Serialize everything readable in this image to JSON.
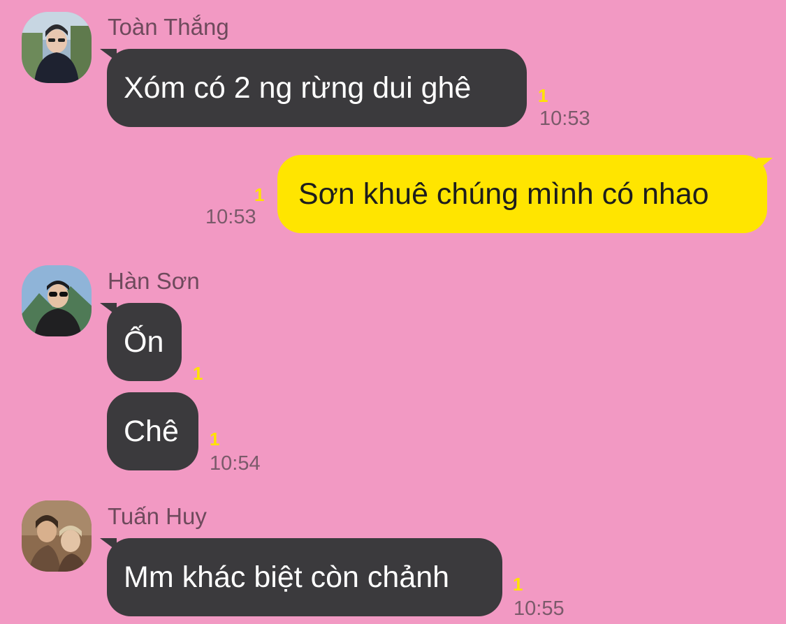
{
  "colors": {
    "background": "#f299c3",
    "incoming_bubble": "#3b3a3d",
    "outgoing_bubble": "#ffe500",
    "unread_count": "#ffe300",
    "meta_text": "#7a5a6a"
  },
  "messages": [
    {
      "sender": "Toàn Thắng",
      "avatar_icon": "avatar-photo-icon",
      "text": "Xóm có 2 ng rừng dui ghê",
      "unread": "1",
      "time": "10:53"
    },
    {
      "direction": "outgoing",
      "text": "Sơn khuê chúng mình có nhao",
      "unread": "1",
      "time": "10:53"
    },
    {
      "sender": "Hàn Sơn",
      "avatar_icon": "avatar-photo-icon",
      "text": "Ốn",
      "unread": "1"
    },
    {
      "text": "Chê",
      "unread": "1",
      "time": "10:54"
    },
    {
      "sender": "Tuấn Huy",
      "avatar_icon": "avatar-photo-icon",
      "text": "Mm khác biệt còn chảnh",
      "unread": "1",
      "time": "10:55"
    }
  ]
}
